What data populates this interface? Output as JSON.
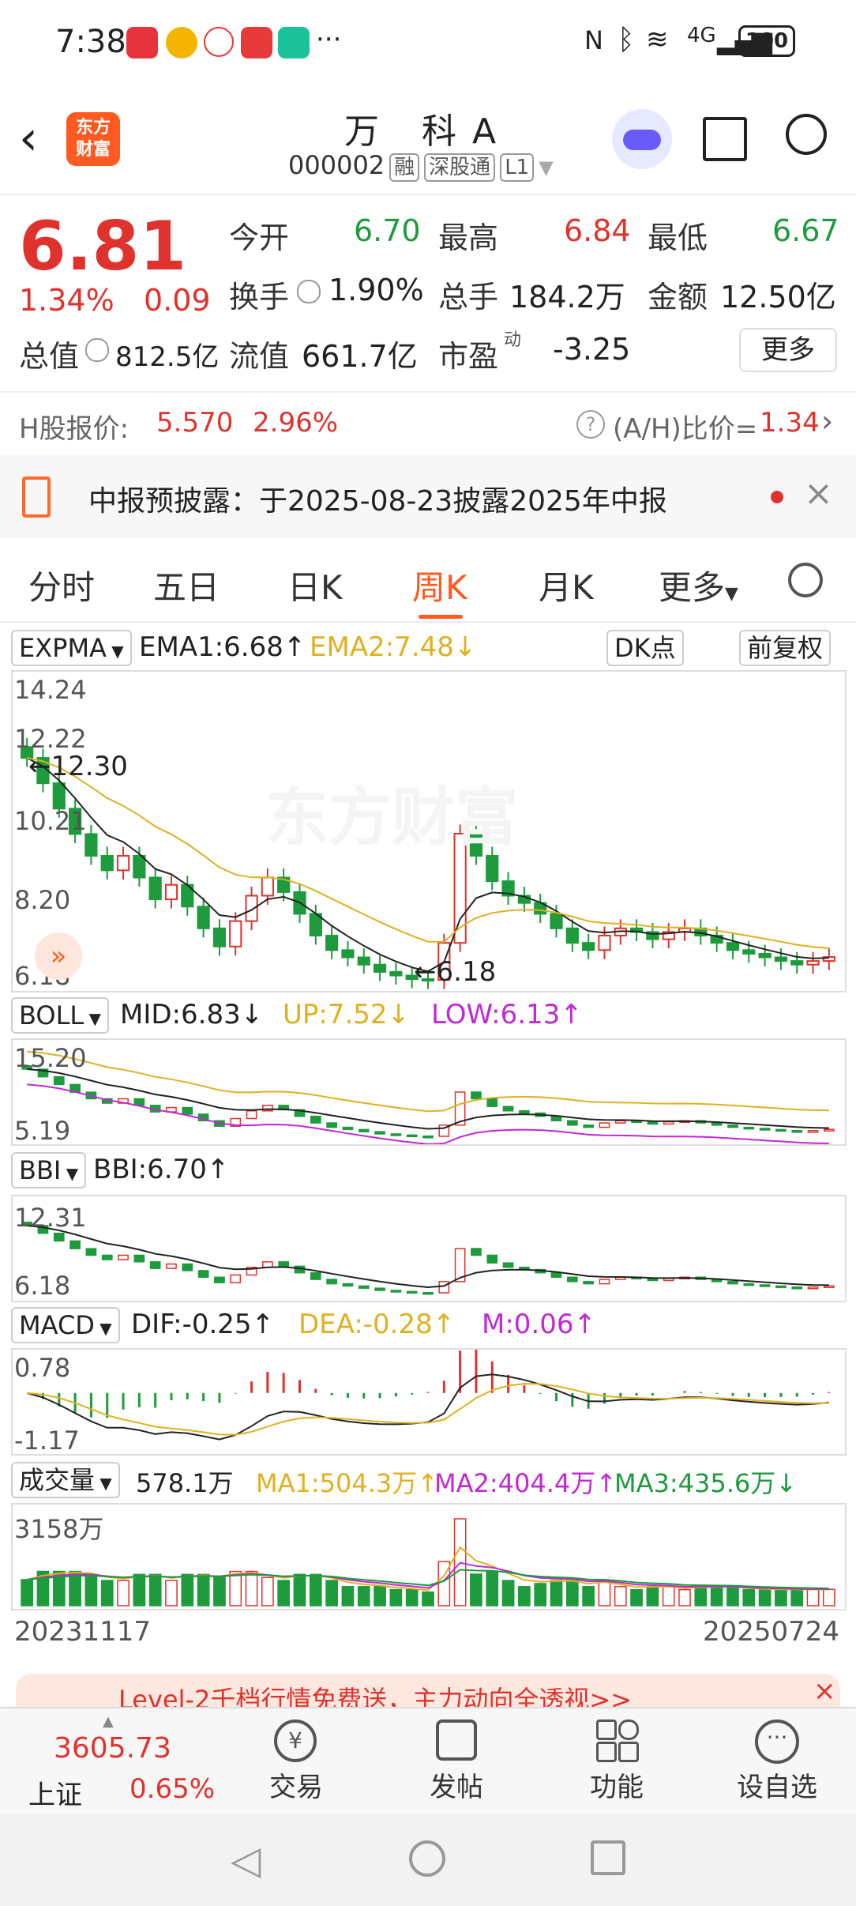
{
  "status": {
    "time": "7:38",
    "battery": "100",
    "network": "4G"
  },
  "header": {
    "title": "万 科A",
    "code": "000002",
    "tags": [
      "融",
      "深股通",
      "L1"
    ],
    "logo_text_1": "东方",
    "logo_text_2": "财富"
  },
  "quote": {
    "price": "6.81",
    "change_pct": "1.34%",
    "change": "0.09",
    "open_label": "今开",
    "open": "6.70",
    "high_label": "最高",
    "high": "6.84",
    "low_label": "最低",
    "low": "6.67",
    "turnover_label": "换手",
    "turnover": "1.90%",
    "volume_label": "总手",
    "volume": "184.2万",
    "amount_label": "金额",
    "amount": "12.50亿",
    "mktcap_label": "总值",
    "mktcap": "812.5亿",
    "float_label": "流值",
    "float": "661.7亿",
    "pe_label": "市盈",
    "pe_sup": "动",
    "pe": "-3.25",
    "more": "更多"
  },
  "hshare": {
    "label": "H股报价:",
    "price": "5.570",
    "pct": "2.96%",
    "ratio_label": "(A/H)比价=",
    "ratio": "1.34"
  },
  "notice": {
    "text": "中报预披露：于2025-08-23披露2025年中报"
  },
  "tabs": [
    "分时",
    "五日",
    "日K",
    "周K",
    "月K",
    "更多"
  ],
  "active_tab": "周K",
  "expma": {
    "name": "EXPMA",
    "ema1": "EMA1:6.68",
    "ema2": "EMA2:7.48",
    "dk": "DK点",
    "adj": "前复权",
    "y_labels": [
      "14.24",
      "12.22",
      "10.21",
      "8.20",
      "6.18"
    ],
    "max_label": "12.30",
    "min_label": "6.18"
  },
  "boll": {
    "name": "BOLL",
    "mid": "MID:6.83",
    "up": "UP:7.52",
    "low": "LOW:6.13",
    "y_top": "15.20",
    "y_bot": "5.19"
  },
  "bbi": {
    "name": "BBI",
    "val": "BBI:6.70",
    "y_top": "12.31",
    "y_bot": "6.18"
  },
  "macd": {
    "name": "MACD",
    "dif": "DIF:-0.25",
    "dea": "DEA:-0.28",
    "m": "M:0.06",
    "y_top": "0.78",
    "y_bot": "-1.17"
  },
  "vol": {
    "name": "成交量",
    "val": "578.1万",
    "ma1": "MA1:504.3万",
    "ma2": "MA2:404.4万",
    "ma3": "MA3:435.6万",
    "y_top": "3158万",
    "date_start": "20231117",
    "date_end": "20250724"
  },
  "banner": {
    "text": "Level-2千档行情免费送，主力动向全透视>>"
  },
  "bottom": {
    "index_value": "3605.73",
    "index_name": "上证",
    "index_pct": "0.65%",
    "nav": [
      "交易",
      "发帖",
      "功能",
      "设自选"
    ]
  },
  "colors": {
    "up": "#e0322c",
    "down": "#1d9b3d",
    "ema2": "#e0b020",
    "accent": "#ff5a1f"
  },
  "chart_data": {
    "type": "candlestick",
    "title": "",
    "period": "weekly",
    "x": [
      "20231117",
      "20250724"
    ],
    "close": [
      12.3,
      11.6,
      10.9,
      10.2,
      9.6,
      9.2,
      9.6,
      9.0,
      8.4,
      8.8,
      8.2,
      7.6,
      7.1,
      7.8,
      8.5,
      9.0,
      8.6,
      8.0,
      7.4,
      7.0,
      6.8,
      6.6,
      6.4,
      6.3,
      6.2,
      6.18,
      7.2,
      10.21,
      9.6,
      8.9,
      8.5,
      8.3,
      8.0,
      7.6,
      7.2,
      7.0,
      7.4,
      7.6,
      7.5,
      7.3,
      7.5,
      7.6,
      7.4,
      7.2,
      7.0,
      6.9,
      6.8,
      6.7,
      6.6,
      6.7,
      6.81
    ],
    "ylim": [
      6.18,
      14.24
    ]
  }
}
